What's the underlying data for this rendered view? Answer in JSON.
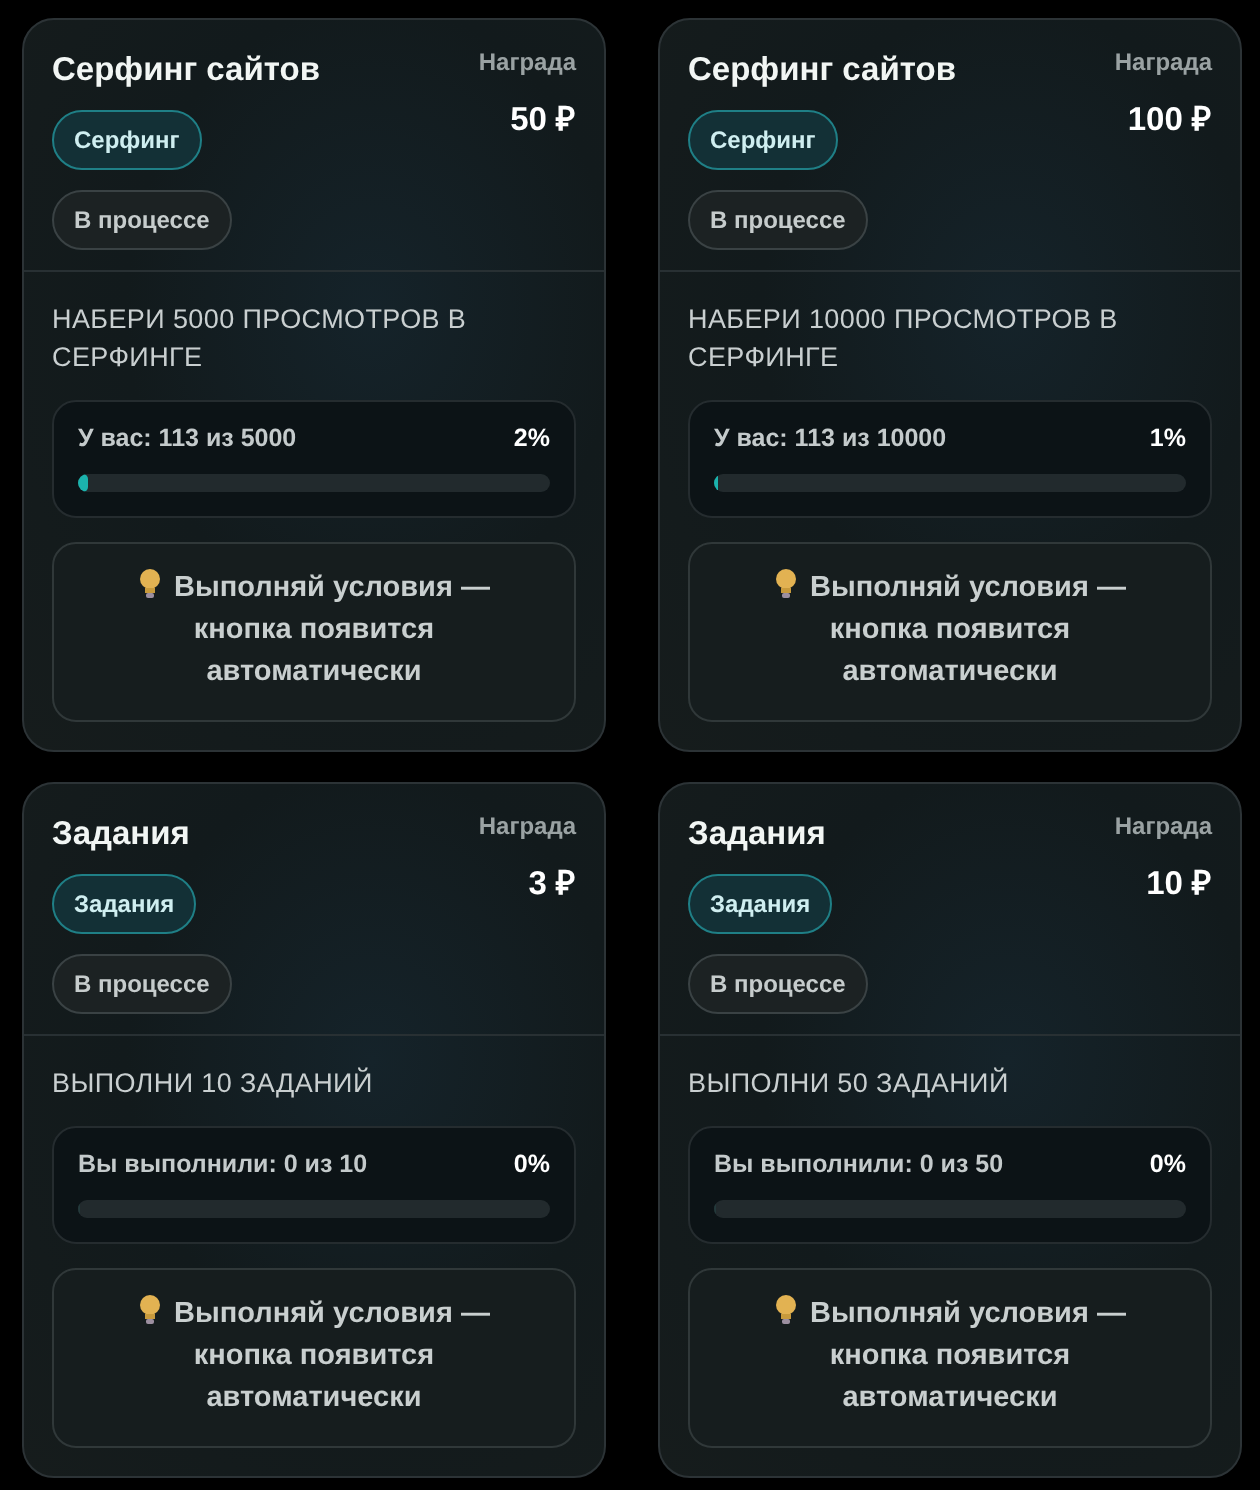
{
  "tasks": [
    {
      "title": "Серфинг сайтов",
      "tag": "Серфинг",
      "status": "В процессе",
      "reward_label": "Награда",
      "reward": "50 ₽",
      "goal": "НАБЕРИ 5000 ПРОСМОТРОВ В СЕРФИНГЕ",
      "progress_text": "У вас: 113 из 5000",
      "percent": "2%",
      "level": 0.02,
      "hint": "Выполняй условия — кнопка появится автоматически"
    },
    {
      "title": "Серфинг сайтов",
      "tag": "Серфинг",
      "status": "В процессе",
      "reward_label": "Награда",
      "reward": "100 ₽",
      "goal": "НАБЕРИ 10000 ПРОСМОТРОВ В СЕРФИНГЕ",
      "progress_text": "У вас: 113 из 10000",
      "percent": "1%",
      "level": 0.01,
      "hint": "Выполняй условия — кнопка появится автоматически"
    },
    {
      "title": "Задания",
      "tag": "Задания",
      "status": "В процессе",
      "reward_label": "Награда",
      "reward": "3 ₽",
      "goal": "ВЫПОЛНИ 10 ЗАДАНИЙ",
      "progress_text": "Вы выполнили: 0 из 10",
      "percent": "0%",
      "level": 0,
      "hint": "Выполняй условия — кнопка появится автоматически"
    },
    {
      "title": "Задания",
      "tag": "Задания",
      "status": "В процессе",
      "reward_label": "Награда",
      "reward": "10 ₽",
      "goal": "ВЫПОЛНИ 50 ЗАДАНИЙ",
      "progress_text": "Вы выполнили: 0 из 50",
      "percent": "0%",
      "level": 0,
      "hint": "Выполняй условия — кнопка появится автоматически"
    }
  ]
}
